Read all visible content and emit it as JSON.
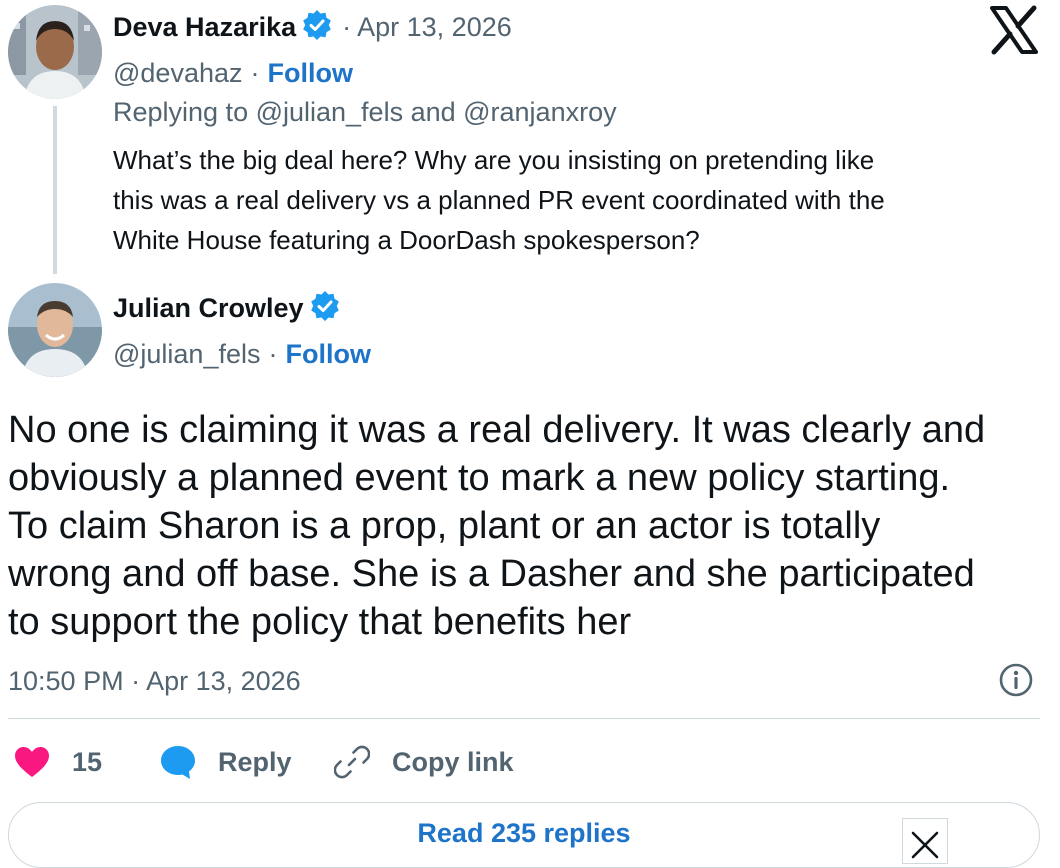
{
  "parent_tweet": {
    "author_name": "Deva Hazarika",
    "date": "· Apr 13, 2026",
    "handle": "@devahaz",
    "separator": "·",
    "follow_label": "Follow",
    "replying_to": "Replying to @julian_fels and @ranjanxroy",
    "text_lines": [
      "What’s the big deal here? Why are you insisting on pretending like",
      "this was a real delivery vs a planned PR event coordinated with the",
      "White House featuring a DoorDash spokesperson?"
    ]
  },
  "main_tweet": {
    "author_name": "Julian Crowley",
    "handle": "@julian_fels",
    "separator": "·",
    "follow_label": "Follow",
    "text_lines": [
      "No one is claiming it was a real delivery. It was clearly and",
      "obviously a planned event to mark a new policy starting.",
      "To claim Sharon is a prop, plant or an actor is totally",
      "wrong and off base. She is a Dasher and she participated",
      "to support the policy that benefits her"
    ],
    "timestamp": "10:50 PM · Apr 13, 2026"
  },
  "actions": {
    "like_count": "15",
    "reply_label": "Reply",
    "copy_link_label": "Copy link"
  },
  "read_replies_label": "Read 235 replies",
  "icons": {
    "brand": "x-logo-icon",
    "verified": "verified-badge-icon",
    "info": "info-icon",
    "like": "heart-icon",
    "reply": "speech-bubble-icon",
    "copy": "link-icon",
    "close": "close-icon"
  },
  "colors": {
    "verified_blue": "#1d9bf0",
    "follow_blue": "#1d74c9",
    "heart_pink": "#f91880",
    "muted_gray": "#536471"
  }
}
